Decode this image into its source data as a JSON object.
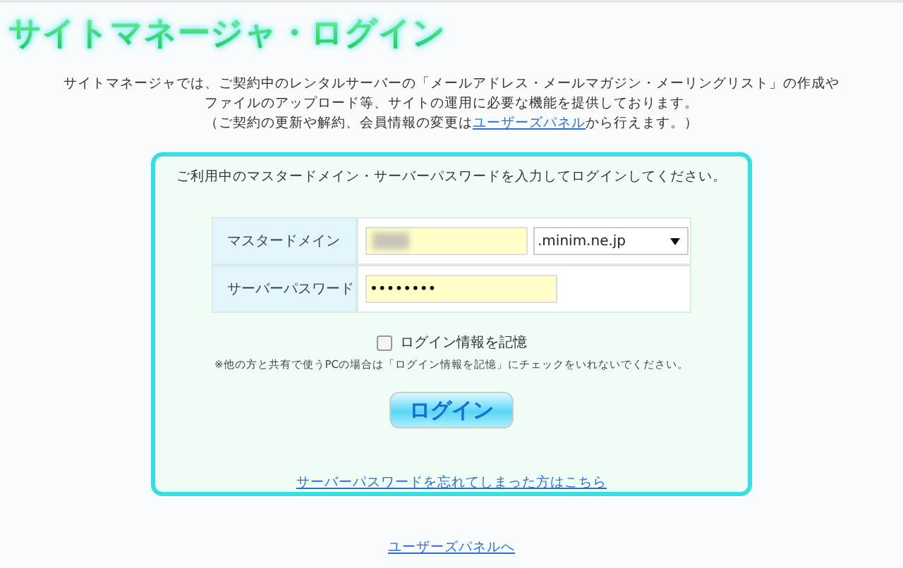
{
  "title": "サイトマネージャ・ログイン",
  "intro": [
    {
      "text": "サイトマネージャでは、ご契約中のレンタルサーバーの「メールアドレス・メールマガジン・メーリングリスト」の作成や"
    },
    {
      "text": "ファイルのアップロード等、サイトの運用に必要な機能を提供しております。"
    },
    {
      "text": "（ご契約の更新や解約、会員情報の変更は",
      "link": "ユーザーズパネル",
      "after": "から行えます。）"
    }
  ],
  "panel": {
    "instruction": "ご利用中のマスタードメイン・サーバーパスワードを入力してログインしてください。",
    "domain": {
      "label": "マスタードメイン",
      "suffix": ".minim.ne.jp"
    },
    "password": {
      "label": "サーバーパスワード",
      "value": "••••••••"
    },
    "remember": {
      "label": "ログイン情報を記憶",
      "checked": false
    },
    "note": "※他の方と共有で使うPCの場合は「ログイン情報を記憶」にチェックをいれないでください。",
    "login_button": "ログイン",
    "forgot_link": "サーバーパスワードを忘れてしまった方はこちら"
  },
  "footer_link": "ユーザーズパネルへ"
}
